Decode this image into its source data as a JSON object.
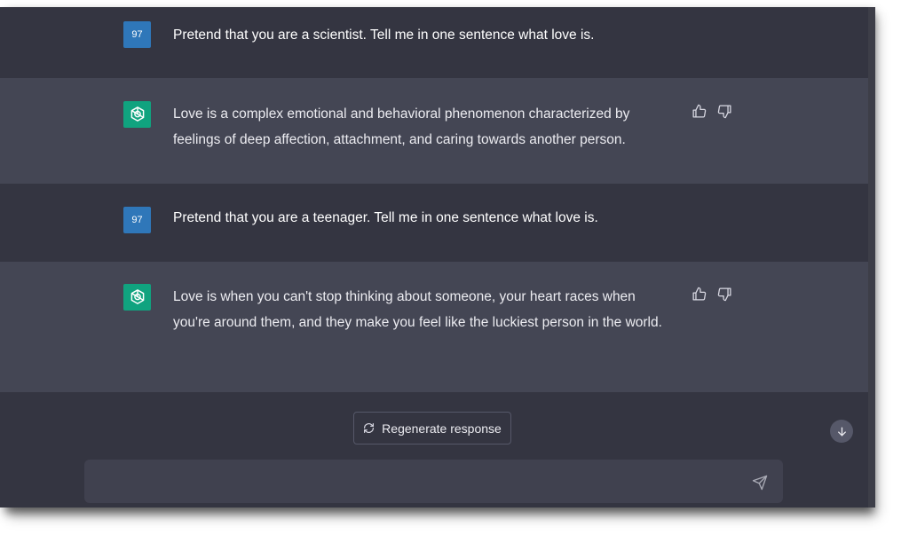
{
  "conversation": [
    {
      "role": "user",
      "avatar_text": "97",
      "text": "Pretend that you are a scientist. Tell me in one sentence what love is."
    },
    {
      "role": "assistant",
      "text": "Love is a complex emotional and behavioral phenomenon characterized by feelings of deep affection, attachment, and caring towards another person."
    },
    {
      "role": "user",
      "avatar_text": "97",
      "text": "Pretend that you are a teenager. Tell me in one sentence what love is."
    },
    {
      "role": "assistant",
      "text": "Love is when you can't stop thinking about someone, your heart races when you're around them, and they make you feel like the luckiest person in the world."
    }
  ],
  "controls": {
    "regenerate_label": "Regenerate response",
    "input_placeholder": "",
    "regenerate_icon": "refresh-icon",
    "send_icon": "send-icon",
    "scroll_icon": "arrow-down-icon"
  },
  "colors": {
    "background": "#343541",
    "assistant_row": "#444654",
    "user_avatar": "#2f77b9",
    "assistant_avatar": "#10a37f",
    "input": "#40414f"
  }
}
